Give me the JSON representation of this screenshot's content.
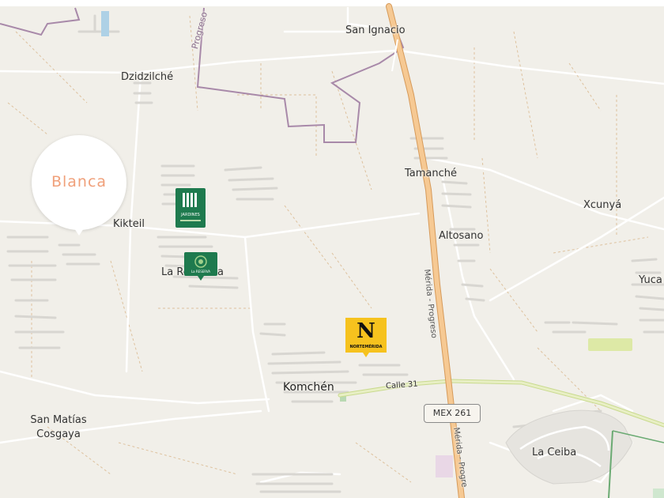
{
  "map": {
    "places": [
      {
        "name": "San Ignacio"
      },
      {
        "name": "Dzidzilché"
      },
      {
        "name": "Tamanché"
      },
      {
        "name": "Xcunyá"
      },
      {
        "name": "Kikteil"
      },
      {
        "name": "Altosano"
      },
      {
        "name": "Yuca"
      },
      {
        "name": "Komchén"
      },
      {
        "name": "San Matías Cosgaya"
      },
      {
        "name": "La Ceiba"
      },
      {
        "name": "La Re"
      },
      {
        "name": "a"
      }
    ],
    "roads": {
      "progreso": "Progreso",
      "merida_progreso": "Mérida - Progreso",
      "merida_progre": "Mérida - Progre",
      "calle31": "Calle 31",
      "mex261": "MEX 261"
    },
    "colors": {
      "background": "#f1efe9",
      "highway": "#f0c08a",
      "boundary": "#a889a9",
      "bubble_text": "#f0a07a",
      "green_marker": "#1e7a4e",
      "yellow_marker": "#f6c21e",
      "calle31": "#dde9a6"
    }
  },
  "pins": {
    "blanca": {
      "label": "Blanca"
    },
    "jardines": {
      "label": "JARDINES",
      "icon": "jardines-logo-icon"
    },
    "reserva": {
      "label": "La RESERVA",
      "icon": "reserva-logo-icon"
    },
    "norte": {
      "letter": "N",
      "label": "NORTEMÉRIDA",
      "icon": "nortemerida-logo-icon"
    }
  }
}
